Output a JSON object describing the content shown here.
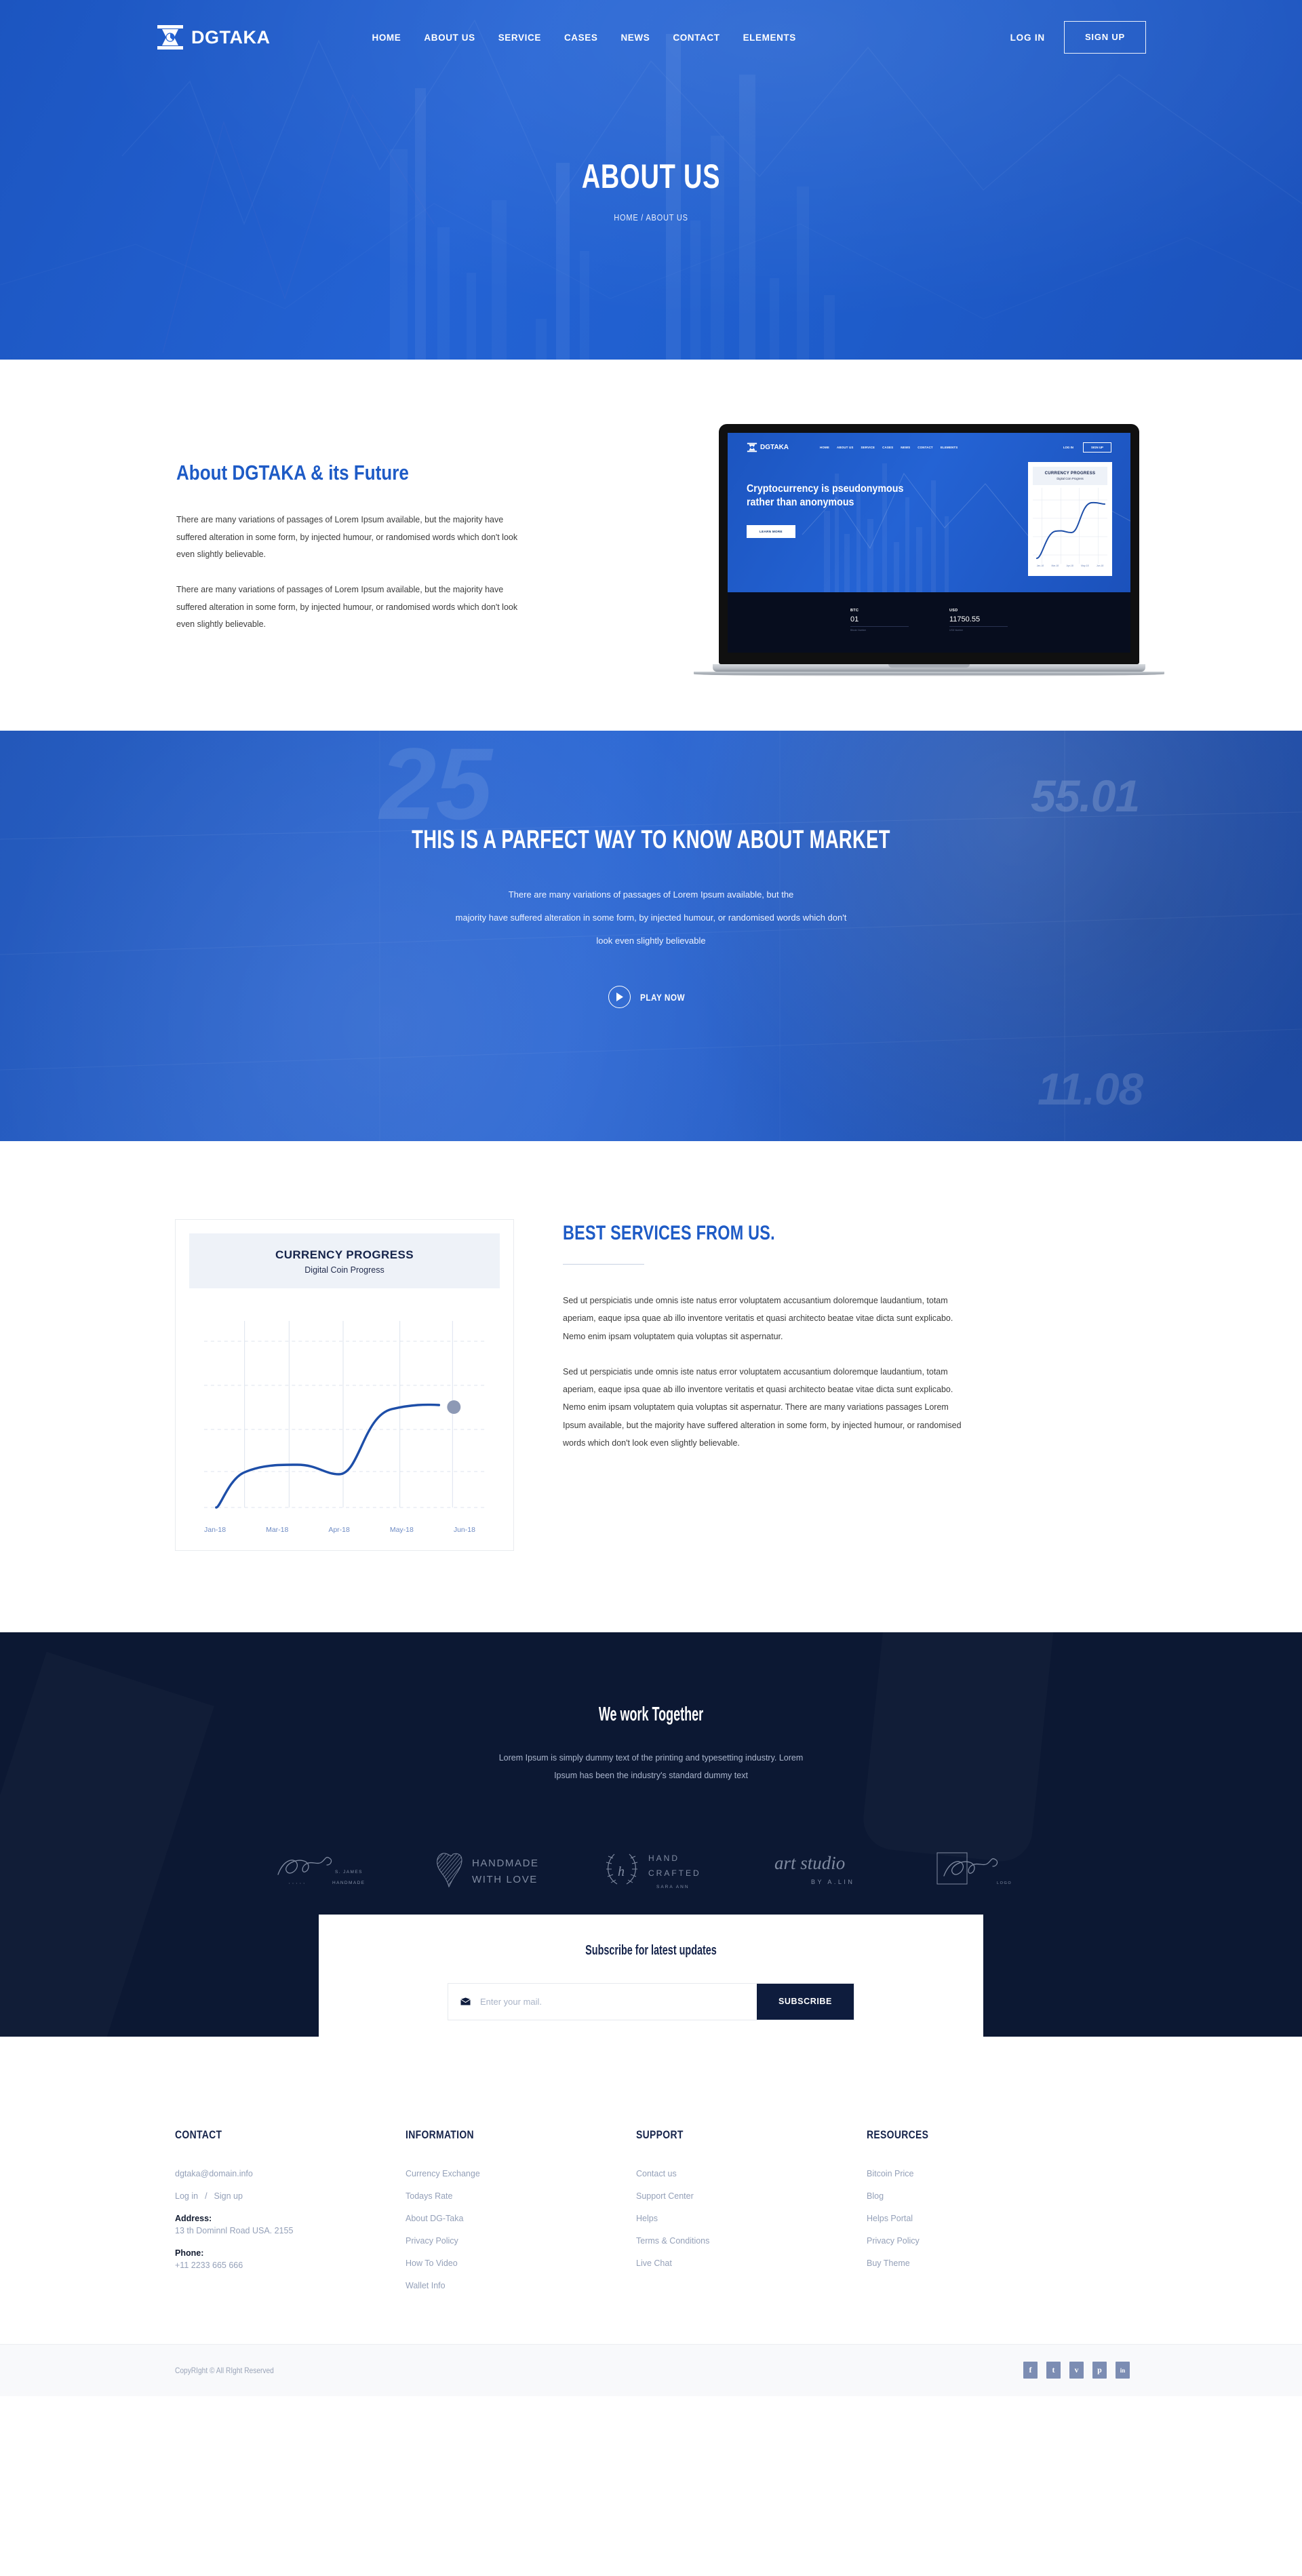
{
  "header": {
    "brand": "DGTAKA",
    "nav": [
      {
        "label": "HOME"
      },
      {
        "label": "ABOUT US"
      },
      {
        "label": "SERVICE"
      },
      {
        "label": "CASES"
      },
      {
        "label": "NEWS"
      },
      {
        "label": "CONTACT"
      },
      {
        "label": "ELEMENTS"
      }
    ],
    "login": "LOG IN",
    "signup": "SIGN UP"
  },
  "hero": {
    "title": "ABOUT US",
    "breadcrumb": "HOME / ABOUT US"
  },
  "about": {
    "title": "About DGTAKA & its Future",
    "paragraphs": [
      "There are many variations of passages of Lorem Ipsum available, but the majority have suffered alteration in some form, by injected humour, or randomised words which don't look even slightly believable.",
      "There are many variations of passages of Lorem Ipsum available, but the majority have suffered alteration in some form, by injected humour, or randomised words which don't look even slightly believable."
    ]
  },
  "laptop": {
    "brand": "DGTAKA",
    "nav": [
      "HOME",
      "ABOUT US",
      "SERVICE",
      "CASES",
      "NEWS",
      "CONTACT",
      "ELEMENTS"
    ],
    "login": "LOG IN",
    "signup": "SIGN UP",
    "headline_line1": "Cryptocurrency is pseudonymous",
    "headline_line2": "rather than anonymous",
    "cta": "LEARN MORE",
    "card": {
      "title": "CURRENCY PROGRESS",
      "subtitle": "Digital Coin Progress",
      "xlabels": [
        "Jan-18",
        "Mar-18",
        "Apr-18",
        "May-18",
        "Jun-18"
      ]
    },
    "stats": [
      {
        "key": "BTC",
        "value": "01",
        "label": "Bitcoin Number"
      },
      {
        "key": "USD",
        "value": "11750.55",
        "label": "USD Number"
      }
    ]
  },
  "video": {
    "title": "THIS IS A PARFECT WAY TO KNOW ABOUT MARKET",
    "paragraph_line1": "There are many variations of passages of Lorem Ipsum available, but the",
    "paragraph_line2": "majority have suffered alteration in some form, by injected humour, or randomised words which don't",
    "paragraph_line3": "look even slightly believable",
    "play_label": "PLAY NOW",
    "bg_numbers": [
      "25",
      "55.01",
      "11.08"
    ]
  },
  "services": {
    "title": "BEST SERVICES FROM US.",
    "paragraphs": [
      "Sed ut perspiciatis unde omnis iste natus error voluptatem accusantium doloremque laudantium, totam aperiam, eaque ipsa quae ab illo inventore veritatis et quasi architecto beatae vitae dicta sunt explicabo. Nemo enim ipsam voluptatem quia voluptas sit aspernatur.",
      "Sed ut perspiciatis unde omnis iste natus error voluptatem accusantium doloremque laudantium, totam aperiam, eaque ipsa quae ab illo inventore veritatis et quasi architecto beatae vitae dicta sunt explicabo. Nemo enim ipsam voluptatem quia voluptas sit aspernatur. There are many variations passages Lorem Ipsum available, but the majority have suffered alteration in some form, by injected humour, or randomised words which don't look even slightly believable."
    ]
  },
  "chart_data": {
    "type": "line",
    "title": "CURRENCY PROGRESS",
    "subtitle": "Digital Coin Progress",
    "xlabel": "",
    "ylabel": "",
    "categories": [
      "Jan-18",
      "Mar-18",
      "Apr-18",
      "May-18",
      "Jun-18"
    ],
    "x": [
      0,
      1,
      2,
      3,
      4,
      5
    ],
    "values": [
      2,
      46,
      52,
      48,
      78,
      80
    ],
    "ylim": [
      0,
      100
    ],
    "grid": true,
    "legend": "none",
    "line_color": "#1d4ea8",
    "end_point_color": "#8d99b5",
    "tick_label_color": "#6f8cc4"
  },
  "partners": {
    "title": "We work Together",
    "paragraph_line1": "Lorem Ipsum is simply dummy text of the printing and typesetting industry. Lorem",
    "paragraph_line2": "Ipsum has been the industry's standard dummy text",
    "logos": [
      {
        "name": "pure-s-james-handmade",
        "main": "pure",
        "sub1": "S. JAMES",
        "sub2": "HANDMADE"
      },
      {
        "name": "handmade-with-love",
        "main": "HANDMADE",
        "sub1": "WITH LOVE",
        "sub2": ""
      },
      {
        "name": "hand-crafted-sara-ann",
        "main": "HAND",
        "sub1": "CRAFTED",
        "sub2": "SARA ANN"
      },
      {
        "name": "art-studio-by-a-lin",
        "main": "art studio",
        "sub1": "BY A.LIN",
        "sub2": ""
      },
      {
        "name": "pure-logo",
        "main": "pure",
        "sub1": "LOGO",
        "sub2": ""
      }
    ]
  },
  "subscribe": {
    "title": "Subscribe for latest updates",
    "placeholder": "Enter your mail.",
    "value": "",
    "button": "SUBSCRIBE"
  },
  "footer": {
    "contact": {
      "heading": "CONTACT",
      "email": "dgtaka@domain.info",
      "login": "Log in",
      "separator": "/",
      "signup": "Sign up",
      "address_label": "Address:",
      "address_value": "13 th Dominnl Road USA. 2155",
      "phone_label": "Phone:",
      "phone_value": "+11 2233 665 666"
    },
    "information": {
      "heading": "INFORMATION",
      "links": [
        "Currency Exchange",
        "Todays Rate",
        "About DG-Taka",
        "Privacy Policy",
        "How To Video",
        "Wallet Info"
      ]
    },
    "support": {
      "heading": "SUPPORT",
      "links": [
        "Contact us",
        "Support Center",
        "Helps",
        "Terms & Conditions",
        "Live Chat"
      ]
    },
    "resources": {
      "heading": "RESOURCES",
      "links": [
        "Bitcoin Price",
        "Blog",
        "Helps Portal",
        "Privacy Policy",
        "Buy Theme"
      ]
    },
    "copyright": "CopyRIght © All RIght Reserved",
    "socials": [
      {
        "name": "facebook-icon",
        "glyph": "f"
      },
      {
        "name": "twitter-icon",
        "glyph": "t"
      },
      {
        "name": "vimeo-icon",
        "glyph": "v"
      },
      {
        "name": "pinterest-icon",
        "glyph": "p"
      },
      {
        "name": "linkedin-icon",
        "glyph": "in"
      }
    ]
  },
  "colors": {
    "brand_blue": "#1e5bc6",
    "hero_blue": "#2463d4",
    "dark_navy": "#0c1833",
    "deep_navy": "#0e1c3d",
    "muted_text": "#94a0b8"
  }
}
